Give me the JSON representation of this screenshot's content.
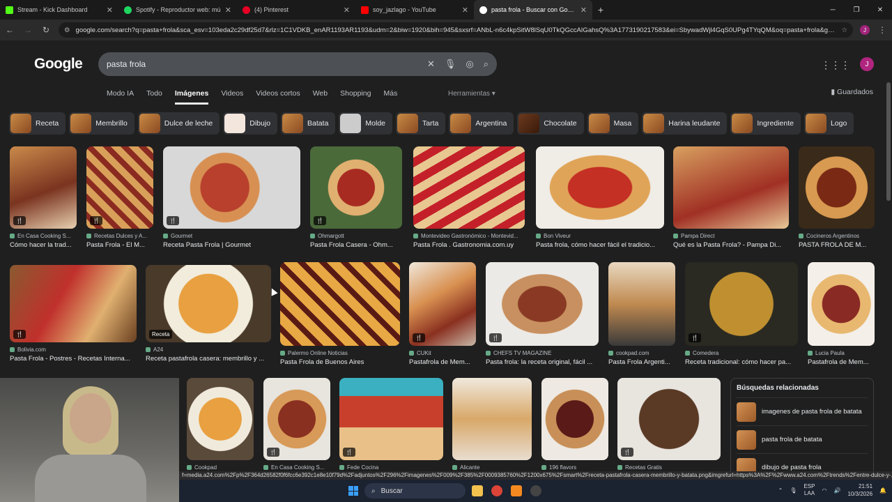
{
  "browser": {
    "tabs": [
      {
        "title": "Stream - Kick Dashboard",
        "color": "#53fc18"
      },
      {
        "title": "Spotify - Reproductor web: mú",
        "color": "#1ed760"
      },
      {
        "title": "(4) Pinterest",
        "color": "#e60023"
      },
      {
        "title": "soy_jazlago - YouTube",
        "color": "#ff0000"
      },
      {
        "title": "pasta frola - Buscar con Google",
        "color": "#4285f4"
      }
    ],
    "url": "google.com/search?q=pasta+frola&sca_esv=103eda2c29df25d7&rlz=1C1VDKB_enAR1193AR1193&udm=2&biw=1920&bih=945&sxsrf=ANbL-n6c4kpSitW8lSqU0TkQGccAIGahsQ%3A1773190217583&ei=SbywadWjl4GqS0UPg4TYqQM&oq=pasta+frola&gs_lp=E...",
    "profile_initial": "J"
  },
  "google": {
    "logo": "Google",
    "query": "pasta frola",
    "nav": [
      "Modo IA",
      "Todo",
      "Imágenes",
      "Videos",
      "Videos cortos",
      "Web",
      "Shopping",
      "Más"
    ],
    "tools": "Herramientas",
    "saved": "Guardados",
    "avatar": "J",
    "chips": [
      "Receta",
      "Membrillo",
      "Dulce de leche",
      "Dibujo",
      "Batata",
      "Molde",
      "Tarta",
      "Argentina",
      "Chocolate",
      "Masa",
      "Harina leudante",
      "Ingrediente",
      "Logo"
    ]
  },
  "results_row1": [
    {
      "source": "En Casa Cooking S...",
      "title": "Cómo hacer la trad..."
    },
    {
      "source": "Recetas Dulces y A...",
      "title": "Pasta Frola - El M..."
    },
    {
      "source": "Gourmet",
      "title": "Receta Pasta Frola | Gourmet"
    },
    {
      "source": "Ohmargott",
      "title": "Pasta Frola Casera - Ohm..."
    },
    {
      "source": "Montevideo Gastronómico - Montevid...",
      "title": "Pasta Frola . Gastronomia.com.uy"
    },
    {
      "source": "Bon Viveur",
      "title": "Pasta frola, cómo hacer fácil el tradicio..."
    },
    {
      "source": "Pampa Direct",
      "title": "Qué es la Pasta Frola? - Pampa Di..."
    },
    {
      "source": "Cocineros Argentinos",
      "title": "PASTA FROLA DE M..."
    }
  ],
  "results_row2": [
    {
      "source": "Bolivia.com",
      "title": "Pasta Frola - Postres - Recetas Interna...",
      "badge": ""
    },
    {
      "source": "A24",
      "title": "Receta pastafrola casera: membrillo y ...",
      "badge": "Receta"
    },
    {
      "source": "Palermo Online Noticias",
      "title": "Pasta Frola de Buenos Aires",
      "badge": ""
    },
    {
      "source": "CUKit",
      "title": "Pastafrola de Mem...",
      "badge": ""
    },
    {
      "source": "CHEFS TV MAGAZINE",
      "title": "Pasta frola: la receta original, fácil ...",
      "badge": ""
    },
    {
      "source": "cookpad.com",
      "title": "Pasta Frola Argenti...",
      "badge": ""
    },
    {
      "source": "Comedera",
      "title": "Receta tradicional: cómo hacer pa...",
      "badge": ""
    },
    {
      "source": "Lucia Paula",
      "title": "Pastafrola de Mem...",
      "badge": ""
    }
  ],
  "results_row3": [
    {
      "source": "Cookpad"
    },
    {
      "source": "En Casa Cooking S..."
    },
    {
      "source": "Fede Cocina"
    },
    {
      "source": "Alicante"
    },
    {
      "source": "196 flavors"
    },
    {
      "source": "Recetas Gratis"
    }
  ],
  "related": {
    "heading": "Búsquedas relacionadas",
    "items": [
      "imagenes de pasta frola de batata",
      "pasta frola de batata",
      "dibujo de pasta frola"
    ]
  },
  "statusbar_url": "f=media.a24.com%2Fp%2F364d26582f0f6fcc6e392c1e8e10f79d%2Fadjuntos%2F296%2Fimagenes%2F009%2F385%2F0009385760%2F1200x675%2Fsmart%2Freceta-pastafrola-casera-membrillo-y-batata.png&imgrefurl=https%3A%2F%2Fwww.a24.com%2Ftrends%2Fentre-dulce-y-...",
  "taskbar": {
    "search": "Buscar",
    "lang": [
      "ESP",
      "LAA"
    ],
    "time": "21:51",
    "date": "10/3/2026"
  }
}
